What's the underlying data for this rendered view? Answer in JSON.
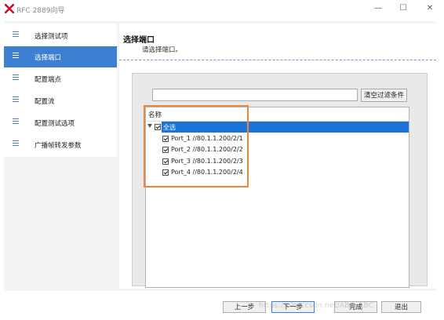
{
  "window": {
    "title": "RFC 2889向导",
    "controls": {
      "minimize": "—",
      "maximize": "☐",
      "close": "✕"
    }
  },
  "sidebar": {
    "items": [
      {
        "label": "选择测试项",
        "active": false
      },
      {
        "label": "选择端口",
        "active": true
      },
      {
        "label": "配置端点",
        "active": false
      },
      {
        "label": "配置流",
        "active": false
      },
      {
        "label": "配置测试选项",
        "active": false
      },
      {
        "label": "广播帧转发参数",
        "active": false
      }
    ]
  },
  "main": {
    "title": "选择端口",
    "subtitle": "请选择端口。",
    "filter": {
      "value": "",
      "placeholder": ""
    },
    "clear_filter_label": "清空过滤条件",
    "tree": {
      "header": "名称",
      "root": {
        "label": "全选",
        "checked": true,
        "expanded": true,
        "selected": true
      },
      "children": [
        {
          "label": "Port_1 //80.1.1.200/2/1",
          "checked": true
        },
        {
          "label": "Port_2 //80.1.1.200/2/2",
          "checked": true
        },
        {
          "label": "Port_3 //80.1.1.200/2/3",
          "checked": true
        },
        {
          "label": "Port_4 //80.1.1.200/2/4",
          "checked": true
        }
      ]
    }
  },
  "footer": {
    "prev_label": "上一步",
    "next_label": "下一步",
    "finish_label": "完成",
    "exit_label": "退出"
  },
  "watermark": "https://blog.csdn.net/ABC_ABC",
  "colors": {
    "accent": "#3d7fd1",
    "selection": "#1c74d8",
    "highlight": "#f0863a",
    "logo": "#c8102e"
  }
}
